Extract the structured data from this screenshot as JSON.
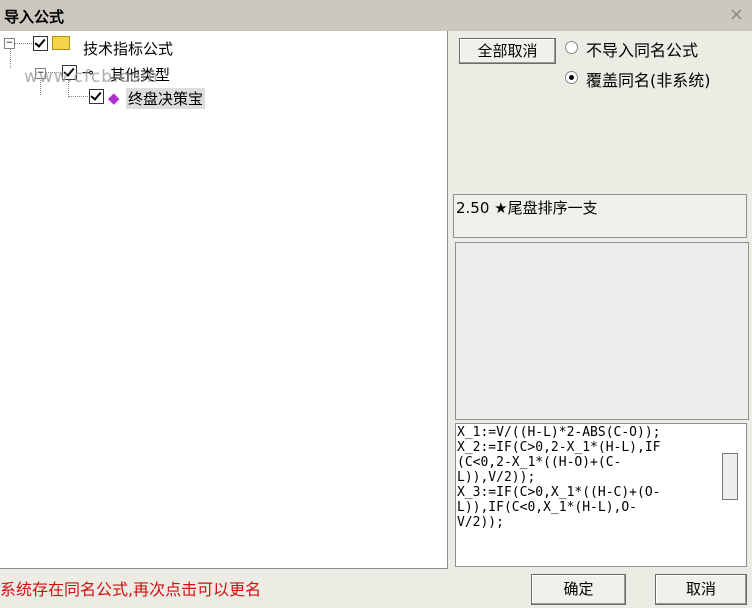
{
  "window": {
    "title": "导入公式",
    "close_label": "×"
  },
  "tree": {
    "watermark": "www.cfcb.com",
    "items": [
      {
        "label": "技术指标公式"
      },
      {
        "label": "其他类型"
      },
      {
        "label": "终盘决策宝"
      }
    ]
  },
  "buttons": {
    "cancel_all": "全部取消",
    "ok": "确定",
    "cancel": "取消"
  },
  "options": [
    {
      "label": "不导入同名公式",
      "selected": false
    },
    {
      "label": "覆盖同名(非系统)",
      "selected": true
    }
  ],
  "info": {
    "version_line": "2.50 ★尾盘排序一支"
  },
  "code_lines": [
    "X_1:=V/((H-L)*2-ABS(C-O));",
    "X_2:=IF(C>0,2-X_1*(H-L),IF",
    "(C<0,2-X_1*((H-O)+(C-",
    "L)),V/2));",
    "X_3:=IF(C>0,X_1*((H-C)+(O-",
    "L)),IF(C<0,X_1*(H-L),O-",
    "V/2));"
  ],
  "status": {
    "message": "系统存在同名公式,再次点击可以更名"
  }
}
